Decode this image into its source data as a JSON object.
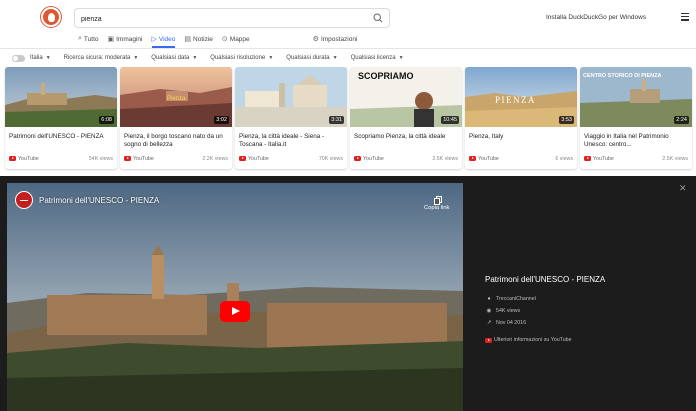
{
  "search": {
    "value": "pienza"
  },
  "header": {
    "install_label": "Installa DuckDuckGo per Windows"
  },
  "tabs": [
    {
      "label": "Tutto",
      "icon": "search-icon"
    },
    {
      "label": "Immagini",
      "icon": "image-icon"
    },
    {
      "label": "Video",
      "icon": "play-icon",
      "active": true
    },
    {
      "label": "Notizie",
      "icon": "news-icon"
    },
    {
      "label": "Mappe",
      "icon": "map-pin-icon"
    },
    {
      "label": "Impostazioni",
      "icon": "settings-icon"
    }
  ],
  "filters": {
    "region": "Italia",
    "safe_search": "Ricerca sicura: moderata",
    "date": "Qualsiasi data",
    "resolution": "Qualsiasi risoluzione",
    "duration": "Qualsiasi durata",
    "license": "Qualsiasi licenza"
  },
  "videos": [
    {
      "title": "Patrimoni dell'UNESCO - PIENZA",
      "duration": "6:08",
      "source": "YouTube",
      "views": "54K views"
    },
    {
      "title": "Pienza, il borgo toscano nato da un sogno di bellezza",
      "duration": "3:02",
      "source": "YouTube",
      "views": "2.2K views",
      "overlay": "Pienza"
    },
    {
      "title": "Pienza, la città ideale - Siena - Toscana - Italia.it",
      "duration": "3:31",
      "source": "YouTube",
      "views": "70K views"
    },
    {
      "title": "Scopriamo Pienza, la città ideale",
      "duration": "10:45",
      "source": "YouTube",
      "views": "2.5K views",
      "overlay": "SCOPRIAMO"
    },
    {
      "title": "Pienza, Italy",
      "duration": "3:53",
      "source": "YouTube",
      "views": "6 views",
      "overlay": "PIENZA"
    },
    {
      "title": "Viaggio in Italia nel Patrimonio Unesco: centro...",
      "duration": "2:24",
      "source": "YouTube",
      "views": "2.5K views",
      "overlay": "CENTRO STORICO DI PIENZA"
    }
  ],
  "player": {
    "title": "Patrimoni dell'UNESCO - PIENZA",
    "copy_label": "Copia link",
    "channel": "TreccaniChannel",
    "views": "54K views",
    "date": "Nov 04 2016",
    "more_info": "Ulteriori informazioni su YouTube"
  }
}
